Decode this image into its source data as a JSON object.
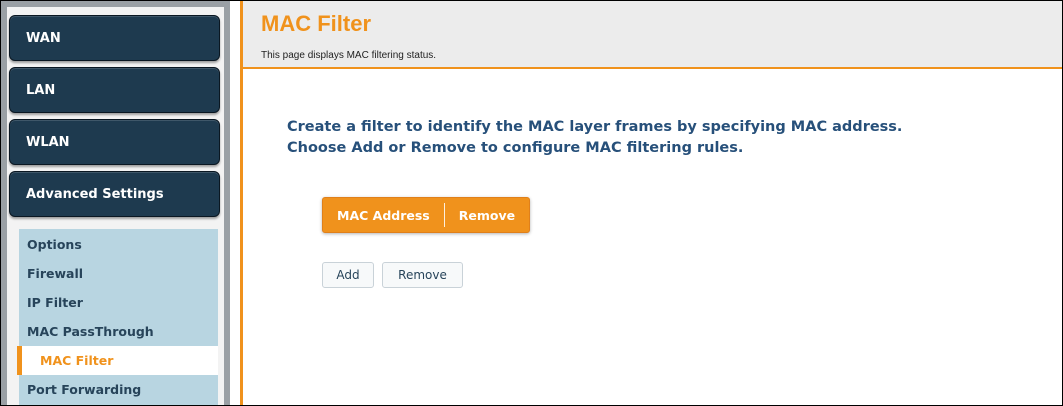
{
  "nav": {
    "main_items": [
      {
        "label": "WAN"
      },
      {
        "label": "LAN"
      },
      {
        "label": "WLAN"
      },
      {
        "label": "Advanced Settings"
      }
    ],
    "sub_items": [
      {
        "label": "Options"
      },
      {
        "label": "Firewall"
      },
      {
        "label": "IP Filter"
      },
      {
        "label": "MAC PassThrough"
      },
      {
        "label": "MAC Filter",
        "active": true
      },
      {
        "label": "Port Forwarding"
      }
    ]
  },
  "header": {
    "title": "MAC Filter",
    "description": "This page displays MAC filtering status."
  },
  "main": {
    "intro_line1": "Create a filter to identify the MAC layer frames by specifying MAC address.",
    "intro_line2": "Choose Add or Remove to configure MAC filtering rules.",
    "table": {
      "columns": [
        "MAC Address",
        "Remove"
      ]
    },
    "buttons": {
      "add_label": "Add",
      "remove_label": "Remove"
    }
  },
  "colors": {
    "accent": "#f0921c",
    "nav_dark": "#1e3a4f",
    "submenu_bg": "#b8d5e1",
    "heading_blue": "#27507a"
  }
}
